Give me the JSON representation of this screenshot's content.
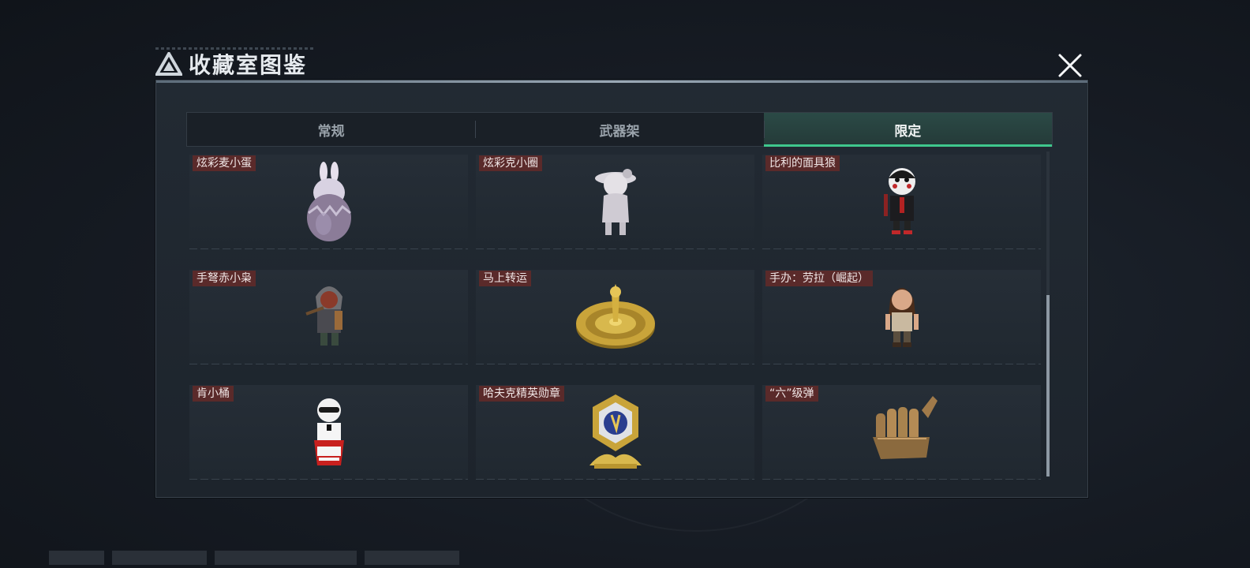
{
  "title": "收藏室图鉴",
  "tabs": [
    {
      "label": "常规",
      "active": false
    },
    {
      "label": "武器架",
      "active": false
    },
    {
      "label": "限定",
      "active": true
    }
  ],
  "items": [
    {
      "label": "炫彩麦小蛋",
      "icon": "rabbit-egg-figure"
    },
    {
      "label": "炫彩克小圈",
      "icon": "girl-figure"
    },
    {
      "label": "比利的面具狼",
      "icon": "puppet-figure"
    },
    {
      "label": "手弩赤小枭",
      "icon": "hooded-archer-figure"
    },
    {
      "label": "马上转运",
      "icon": "golden-wheel"
    },
    {
      "label": "手办：劳拉（崛起）",
      "icon": "lara-figure"
    },
    {
      "label": "肯小桶",
      "icon": "colonel-figure"
    },
    {
      "label": "哈夫克精英勋章",
      "icon": "medal-trophy"
    },
    {
      "label": "“六”级弹",
      "icon": "bullet-hand"
    }
  ],
  "colors": {
    "accent": "#3fc78d",
    "label_bg": "#5a2a2a",
    "gold": "#c9a43a"
  }
}
